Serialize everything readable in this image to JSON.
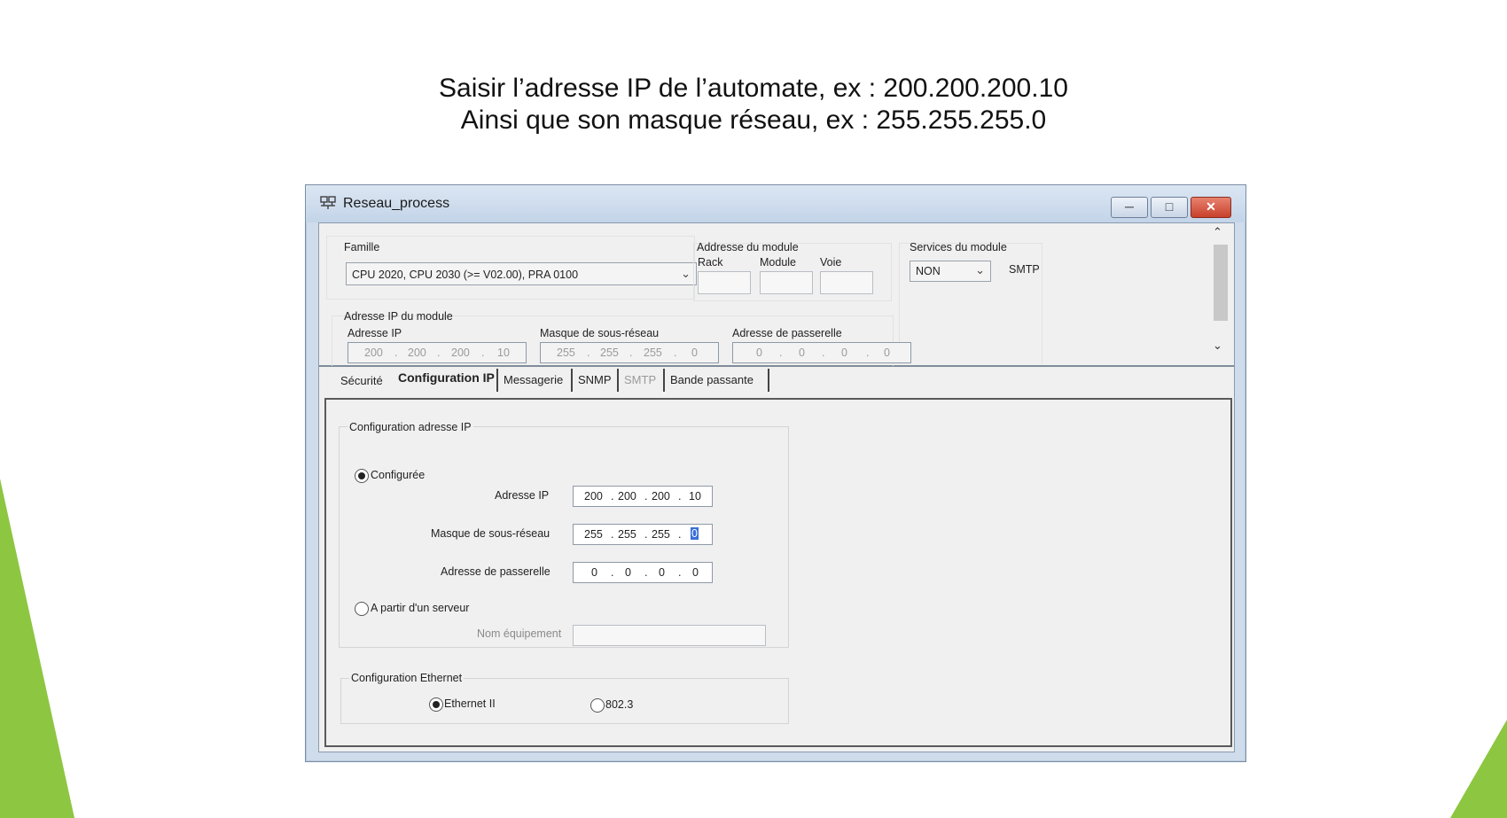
{
  "slide": {
    "line1": "Saisir l’adresse IP de l’automate, ex : 200.200.200.10",
    "line2": "Ainsi que son masque réseau, ex : 255.255.255.0",
    "accent_color": "#8dc641"
  },
  "window": {
    "title": "Reseau_process",
    "app_icon": "network-icon",
    "controls": {
      "minimize_icon": "minimize-icon",
      "maximize_icon": "maximize-icon",
      "close_icon": "close-icon",
      "close_color": "#c8402b"
    }
  },
  "module": {
    "famille_label": "Famille",
    "famille_value": "CPU 2020, CPU 2030 (>= V02.00), PRA 0100",
    "address_group_label": "Addresse du module",
    "rack_label": "Rack",
    "module_label": "Module",
    "voie_label": "Voie",
    "services_label": "Services du module",
    "services_value": "NON",
    "smtp_label": "SMTP",
    "ip_group_label": "Adresse IP du module",
    "ip_label": "Adresse IP",
    "ip_octets": [
      "200",
      "200",
      "200",
      "10"
    ],
    "mask_label": "Masque de sous-réseau",
    "mask_octets": [
      "255",
      "255",
      "255",
      "0"
    ],
    "gateway_label": "Adresse de passerelle",
    "gateway_octets": [
      "0",
      "0",
      "0",
      "0"
    ]
  },
  "tabs": [
    {
      "label": "Sécurité"
    },
    {
      "label": "Configuration IP"
    },
    {
      "label": "Messagerie"
    },
    {
      "label": "SNMP"
    },
    {
      "label": "SMTP"
    },
    {
      "label": "Bande passante"
    }
  ],
  "config_ip": {
    "group_label": "Configuration adresse IP",
    "configured_label": "Configurée",
    "ip_label": "Adresse IP",
    "ip_octets": [
      "200",
      "200",
      "200",
      "10"
    ],
    "mask_label": "Masque de sous-réseau",
    "mask_octets": [
      "255",
      "255",
      "255",
      "0"
    ],
    "gateway_label": "Adresse de passerelle",
    "gateway_octets": [
      "0",
      "0",
      "0",
      "0"
    ],
    "server_label": "A partir d'un serveur",
    "device_name_label": "Nom équipement",
    "device_name_value": ""
  },
  "ethernet": {
    "group_label": "Configuration Ethernet",
    "option1": "Ethernet II",
    "option2": "802.3"
  }
}
